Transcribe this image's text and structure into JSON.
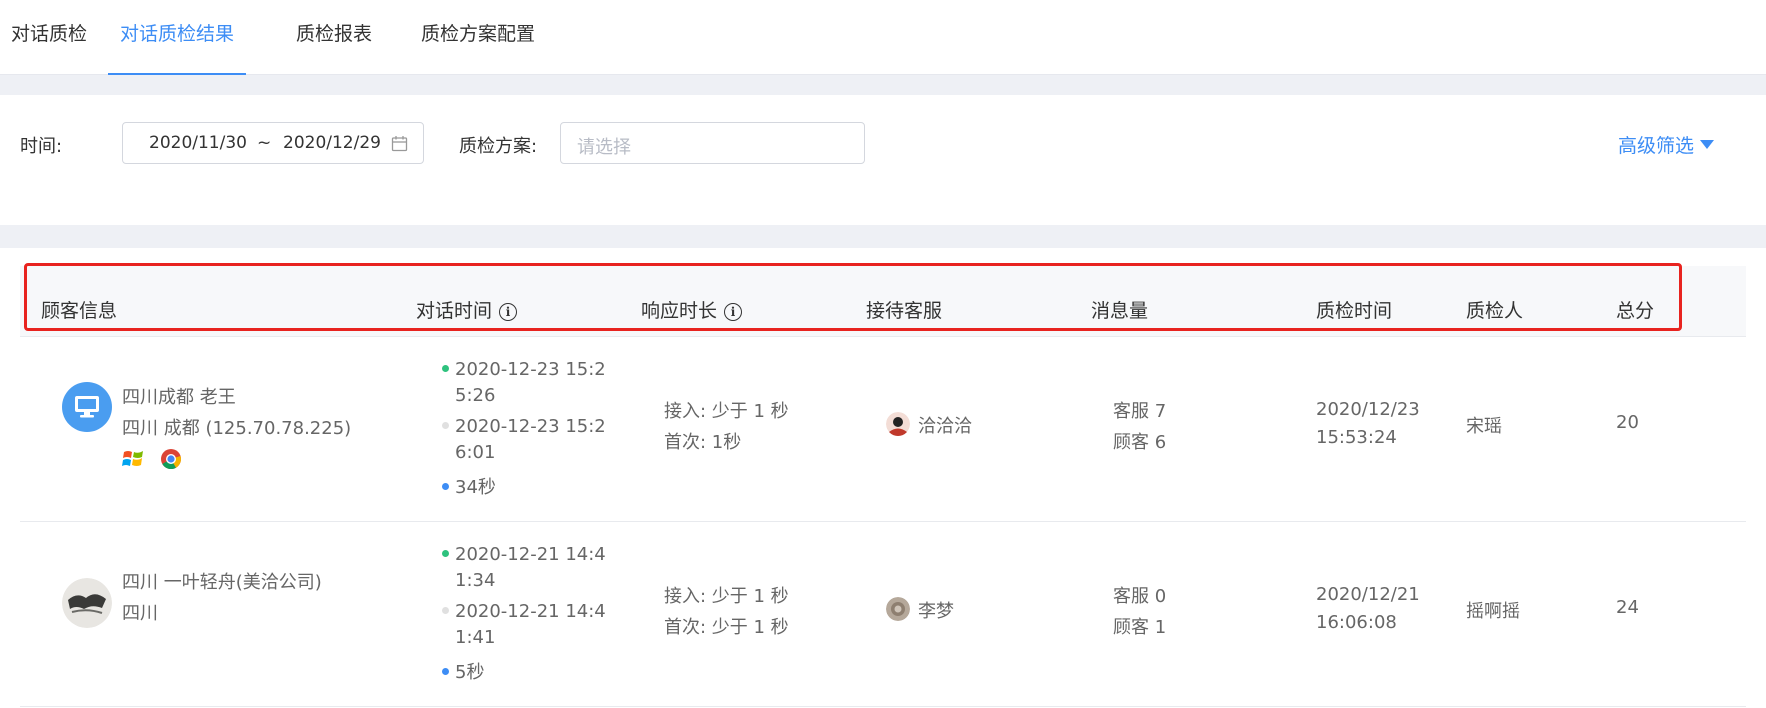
{
  "tabs": [
    {
      "label": "对话质检"
    },
    {
      "label": "对话质检结果"
    },
    {
      "label": "质检报表"
    },
    {
      "label": "质检方案配置"
    }
  ],
  "filter": {
    "time_label": "时间:",
    "date_start": "2020/11/30",
    "date_sep": "~",
    "date_end": "2020/12/29",
    "scheme_label": "质检方案:",
    "scheme_placeholder": "请选择",
    "advanced_label": "高级筛选"
  },
  "table": {
    "headers": [
      "顾客信息",
      "对话时间",
      "响应时长",
      "接待客服",
      "消息量",
      "质检时间",
      "质检人",
      "总分"
    ],
    "rows": [
      {
        "customer_name": "四川成都 老王",
        "customer_location": "四川 成都 (125.70.78.225)",
        "time_start_1": "2020-12-23 15:2",
        "time_start_2": "5:26",
        "time_end_1": "2020-12-23 15:2",
        "time_end_2": "6:01",
        "duration": "34秒",
        "resp_access": "接入: 少于 1 秒",
        "resp_first": "首次: 1秒",
        "agent": "洽洽洽",
        "msg_agent": "客服 7",
        "msg_customer": "顾客 6",
        "qc_date": "2020/12/23",
        "qc_time": "15:53:24",
        "inspector": "宋瑶",
        "score": "20"
      },
      {
        "customer_name": "四川 一叶轻舟(美洽公司)",
        "customer_location": "四川",
        "time_start_1": "2020-12-21 14:4",
        "time_start_2": "1:34",
        "time_end_1": "2020-12-21 14:4",
        "time_end_2": "1:41",
        "duration": "5秒",
        "resp_access": "接入: 少于 1 秒",
        "resp_first": "首次: 少于 1 秒",
        "agent": "李梦",
        "msg_agent": "客服 0",
        "msg_customer": "顾客 1",
        "qc_date": "2020/12/21",
        "qc_time": "16:06:08",
        "inspector": "摇啊摇",
        "score": "24"
      }
    ]
  },
  "colors": {
    "accent": "#3d8df5",
    "highlight": "#e8231f",
    "dot_start": "#2ec27e",
    "dot_end": "#e0e0e0",
    "dot_duration": "#3d8df5"
  }
}
